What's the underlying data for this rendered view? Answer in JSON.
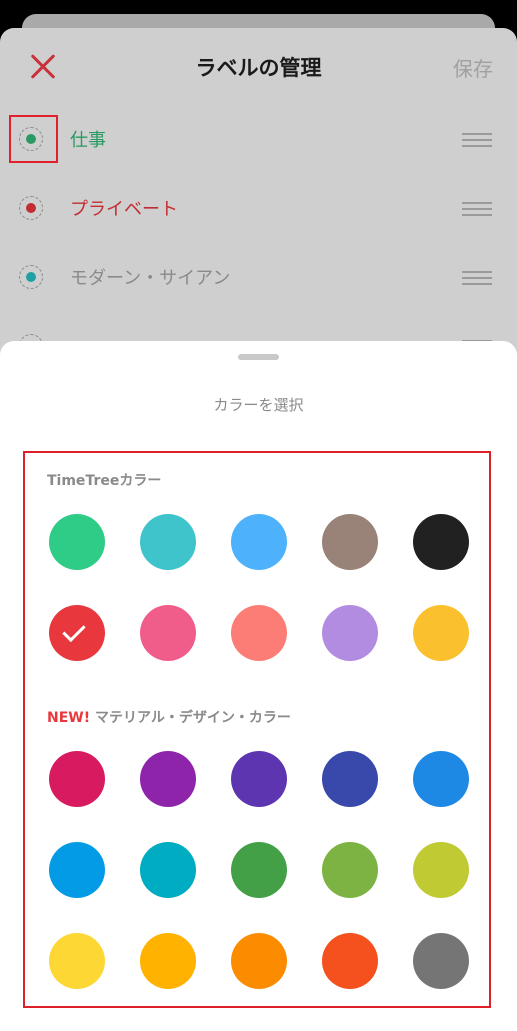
{
  "header": {
    "title": "ラベルの管理",
    "save_label": "保存"
  },
  "labels": [
    {
      "name": "仕事",
      "color": "#2a9a62"
    },
    {
      "name": "プライベート",
      "color": "#c22d32"
    },
    {
      "name": "モダーン・サイアン",
      "color": "#20a0a5"
    },
    {
      "name": "",
      "color": "#3a8fb8"
    }
  ],
  "picker": {
    "title": "カラーを選択",
    "section_timetree": "TimeTreeカラー",
    "section_new_tag": "NEW!",
    "section_material": " マテリアル・デザイン・カラー",
    "selected_color": "#e8383d",
    "timetree_colors": [
      "#2ecc87",
      "#40c4cc",
      "#4db2fb",
      "#998277",
      "#212121",
      "#e8383d",
      "#f05d8b",
      "#fb7d76",
      "#b28ce0",
      "#fbc02d"
    ],
    "material_colors": [
      "#d81b60",
      "#8e24aa",
      "#5e35b1",
      "#3949ab",
      "#1e88e5",
      "#039be5",
      "#00acc1",
      "#43a047",
      "#7cb342",
      "#c0ca33",
      "#fdd835",
      "#ffb300",
      "#fb8c00",
      "#f4511e",
      "#757575"
    ]
  }
}
